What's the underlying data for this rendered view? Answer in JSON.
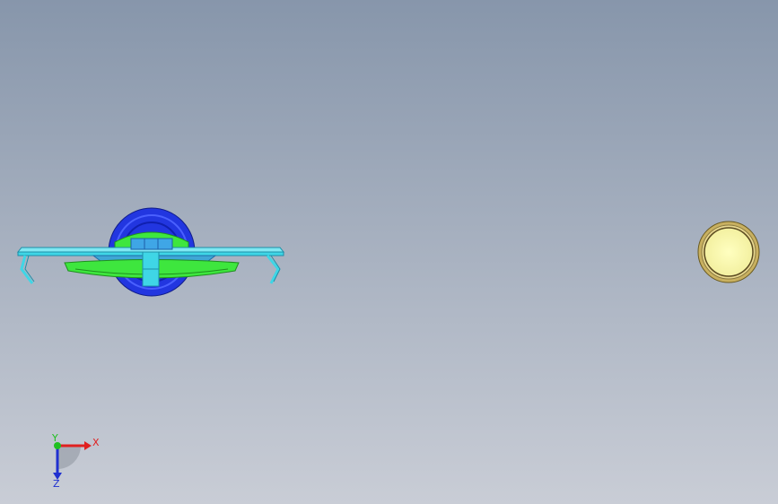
{
  "viewport": {
    "background_top": "#8796ab",
    "background_bottom": "#c9cdd6"
  },
  "triad": {
    "x_label": "X",
    "y_label": "Y",
    "z_label": "Z",
    "x_color": "#e02020",
    "y_color": "#20c020",
    "z_color": "#2030d0"
  },
  "model": {
    "colors": {
      "cyan": "#3fd6e6",
      "cyan_dark": "#1d8fa8",
      "green": "#3ee63e",
      "green_dark": "#1f8f1f",
      "blue": "#2236e0",
      "blue_dark": "#101c8a",
      "disc_fill": "#ffffb0",
      "disc_rim": "#8a7a40"
    }
  }
}
